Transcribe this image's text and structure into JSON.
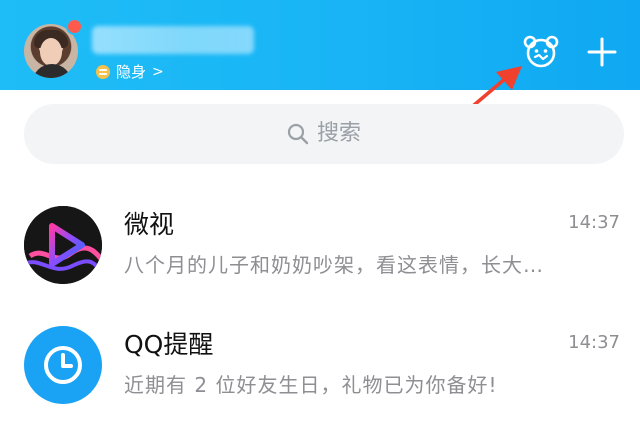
{
  "header": {
    "status_label": "隐身",
    "status_chevron": ">",
    "icons": [
      "avatar",
      "notification-dot",
      "status-icon",
      "bear-icon",
      "plus-icon"
    ],
    "colors": {
      "header_bg": "#18b4f5",
      "notification_dot": "#ff5a4b",
      "status_icon": "#f5c14d",
      "annotation_arrow": "#f0412f"
    }
  },
  "search": {
    "placeholder": "搜索",
    "icon": "search-icon"
  },
  "chats": [
    {
      "title": "微视",
      "time": "14:37",
      "preview": "八个月的儿子和奶奶吵架，看这表情，长大…",
      "icon": "weishi-play-icon"
    },
    {
      "title": "QQ提醒",
      "time": "14:37",
      "preview": "近期有 2 位好友生日，礼物已为你备好!",
      "icon": "clock-icon"
    }
  ]
}
